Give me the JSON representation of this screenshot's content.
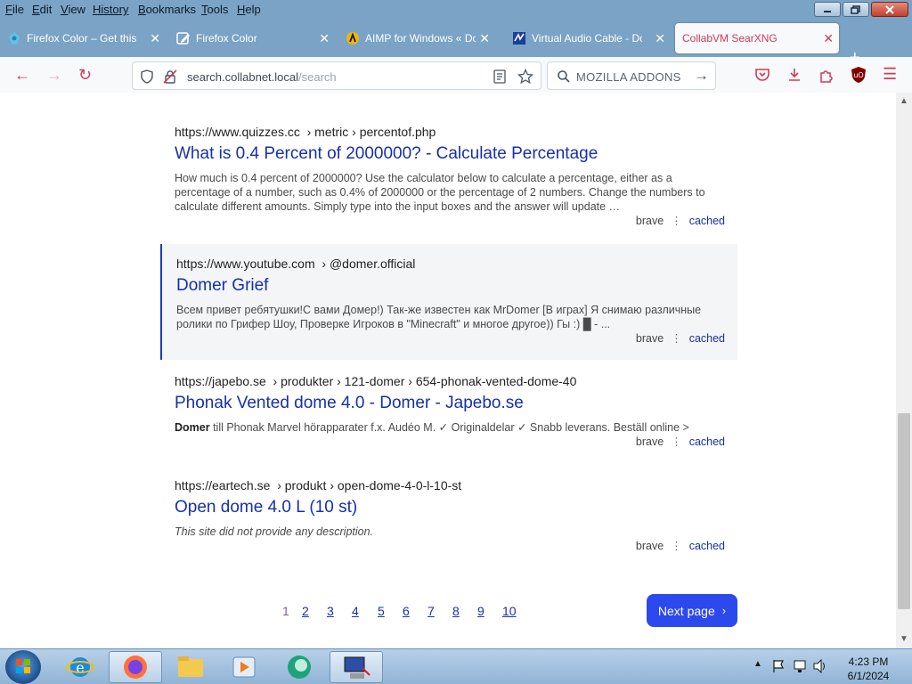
{
  "menu": [
    {
      "label": "File",
      "key": "F",
      "rest": "ile"
    },
    {
      "label": "Edit",
      "key": "E",
      "rest": "dit"
    },
    {
      "label": "View",
      "key": "V",
      "rest": "iew"
    },
    {
      "label": "History",
      "key": "",
      "rest": "History"
    },
    {
      "label": "Bookmarks",
      "key": "B",
      "rest": "ookmarks"
    },
    {
      "label": "Tools",
      "key": "T",
      "rest": "ools"
    },
    {
      "label": "Help",
      "key": "H",
      "rest": "elp"
    }
  ],
  "tabs": [
    {
      "title": "Firefox Color – Get this E",
      "icon": "firefox-color-icon",
      "active": false
    },
    {
      "title": "Firefox Color",
      "icon": "edit-page-icon",
      "active": false
    },
    {
      "title": "AIMP for Windows « Do",
      "icon": "aimp-icon",
      "active": false
    },
    {
      "title": "Virtual Audio Cable - Do",
      "icon": "vac-icon",
      "active": false
    },
    {
      "title": "CollabVM SearXNG",
      "icon": "",
      "active": true
    }
  ],
  "navbar": {
    "url_domain": "search.collabnet.local",
    "url_path": "/search",
    "search_label": "MOZILLA ADDONS"
  },
  "results": [
    {
      "url": "https://www.quizzes.cc",
      "path": "› metric › percentof.php",
      "title": "What is 0.4 Percent of 2000000? - Calculate Percentage",
      "desc_bold": "",
      "desc": "How much is 0.4 percent of 2000000? Use the calculator below to calculate a percentage, either as a percentage of a number, such as 0.4% of 2000000 or the percentage of 2 numbers. Change the numbers to calculate different amounts. Simply type into the input boxes and the answer will update …",
      "engine": "brave",
      "cached": "cached",
      "highlight": false
    },
    {
      "url": "https://www.youtube.com",
      "path": "› @domer.official",
      "title": "Domer Grief",
      "desc_bold": "",
      "desc": "Всем привет ребятушки!С вами Домер!) Так-же известен как MrDomer [В играх] Я снимаю различные ролики по Грифер Шоу, Проверке Игроков в \"Minecraft\" и многое другое)) Гы :) █ - ...",
      "engine": "brave",
      "cached": "cached",
      "highlight": true
    },
    {
      "url": "https://japebo.se",
      "path": "› produkter › 121-domer › 654-phonak-vented-dome-40",
      "title": "Phonak Vented dome 4.0 - Domer - Japebo.se",
      "desc_bold": "Domer",
      "desc": " till Phonak Marvel hörapparater f.x. Audéo M. ✓ Originaldelar ✓ Snabb leverans. Beställ online >",
      "engine": "brave",
      "cached": "cached",
      "highlight": false
    },
    {
      "url": "https://eartech.se",
      "path": "› produkt › open-dome-4-0-l-10-st",
      "title": "Open dome 4.0 L (10 st)",
      "desc_bold": "",
      "desc": "This site did not provide any description.",
      "engine": "brave",
      "cached": "cached",
      "highlight": false
    }
  ],
  "pager": {
    "pages": [
      "1",
      "2",
      "3",
      "4",
      "5",
      "6",
      "7",
      "8",
      "9",
      "10"
    ],
    "current": "1",
    "next_label": "Next page"
  },
  "taskbar": {
    "time": "4:23 PM",
    "date": "6/1/2024"
  },
  "colors": {
    "chrome": "#7aa3c6",
    "accent": "#d13a55",
    "link": "#1730a7",
    "next_button": "#2c49ee"
  }
}
